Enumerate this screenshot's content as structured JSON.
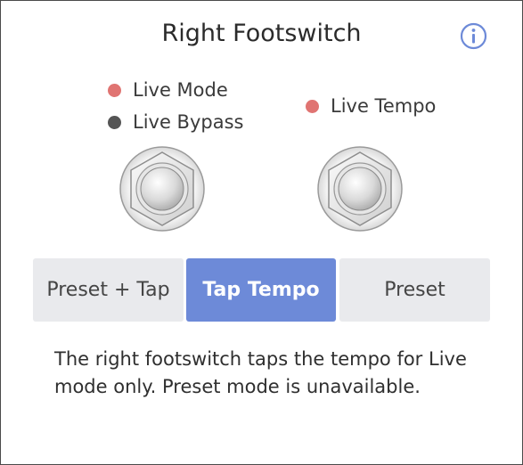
{
  "title": "Right Footswitch",
  "info_icon": "info-circle-icon",
  "left_indicators": [
    {
      "label": "Live Mode",
      "color": "#e07472"
    },
    {
      "label": "Live Bypass",
      "color": "#555555"
    }
  ],
  "right_indicators": [
    {
      "label": "Live Tempo",
      "color": "#e07472"
    }
  ],
  "footswitch_icon": "footswitch-icon",
  "segments": {
    "preset_tap": "Preset + Tap",
    "tap_tempo": "Tap Tempo",
    "preset": "Preset",
    "selected": "Tap Tempo"
  },
  "description": "The right footswitch taps the tempo for Live mode only. Preset mode is unavailable.",
  "colors": {
    "accent": "#6d8ad8",
    "indicator_red": "#e07472",
    "indicator_dark": "#555555",
    "segment_bg": "#e9eaed"
  }
}
